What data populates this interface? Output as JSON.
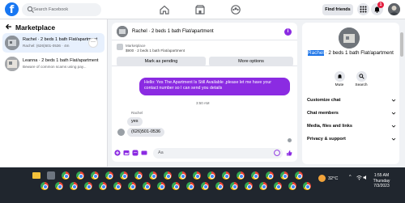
{
  "topbar": {
    "logo": "f",
    "search_placeholder": "Search Facebook",
    "find_friends": "Find friends",
    "notification_count": "1"
  },
  "sidebar": {
    "title": "Marketplace",
    "conversations": [
      {
        "name": "Rachel · 2 beds 1 bath Flat/apartment",
        "preview": "Rachel: (626)501-0536 · 4m",
        "more": "···"
      },
      {
        "name": "Leanna · 2 beds 1 bath Flat/apartment",
        "preview": "Beware of common scams using pay..."
      }
    ]
  },
  "chat": {
    "title": "Rachel · 2 beds 1 bath Flat/apartment",
    "info_icon": "i",
    "listing_label": "Marketplace",
    "listing_price": "$900 · 2 beds 1 bath Flat/apartment",
    "mark_pending": "Mark as pending",
    "more_options": "More options",
    "outgoing_message": "Hello: Yes The Apartment Is Still Available ,please let me have your contact number so I can send you details",
    "timestamp": "3:50 AM",
    "sender": "Rachel",
    "incoming": [
      "yes",
      "(626)501-0536"
    ],
    "composer_placeholder": "Aa"
  },
  "right": {
    "name_highlight": "Rachel",
    "name_rest": " · 2 beds 1 bath Flat/apartment",
    "actions": [
      {
        "label": "Mute"
      },
      {
        "label": "Search"
      }
    ],
    "rows": [
      "Customize chat",
      "Chat members",
      "Media, files and links",
      "Privacy & support"
    ]
  },
  "taskbar": {
    "temperature": "32°C",
    "time": "1:55 AM",
    "day": "Thursday",
    "date": "7/3/2023"
  },
  "colors": {
    "fb_blue": "#1877f2",
    "message_purple": "#8b2be2",
    "taskbar": "#20262e"
  }
}
